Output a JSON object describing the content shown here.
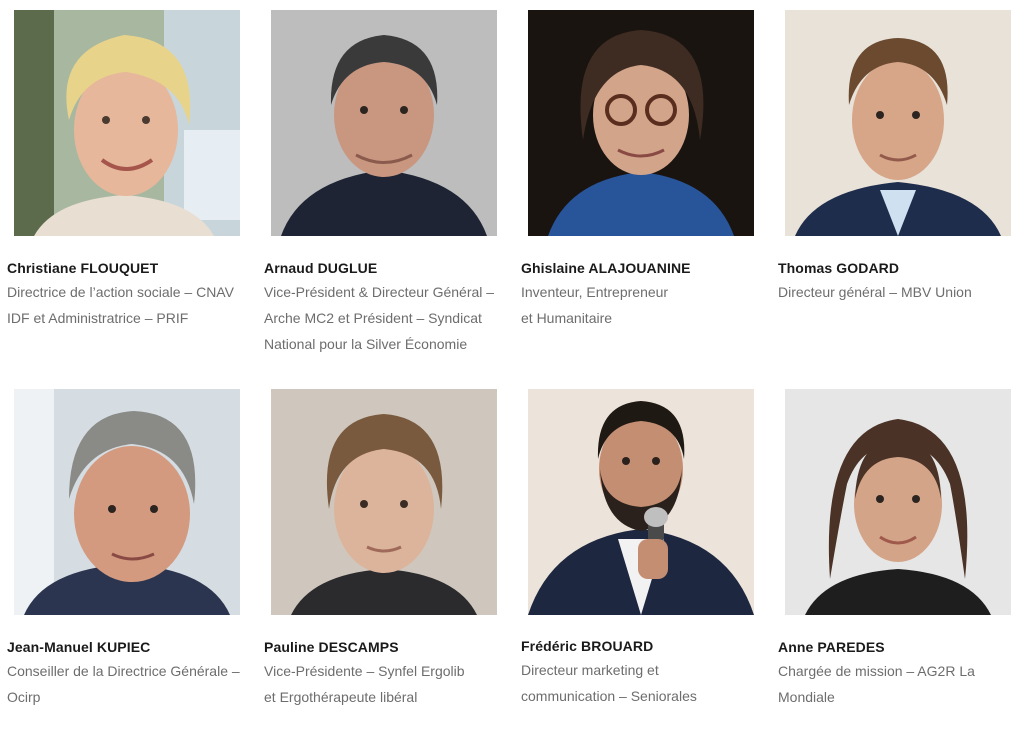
{
  "people": [
    {
      "name": "Christiane FLOUQUET",
      "lines": [
        "Directrice de l’action sociale – CNAV",
        "IDF  et Administratrice – PRIF"
      ]
    },
    {
      "name": "Arnaud DUGLUE",
      "lines": [
        "Vice-Président & Directeur Général –",
        "Arche MC2  et Président – Syndicat",
        "National pour la Silver Économie"
      ]
    },
    {
      "name": "Ghislaine ALAJOUANINE",
      "lines": [
        "Inventeur, Entrepreneur",
        "et Humanitaire"
      ]
    },
    {
      "name": "Thomas GODARD",
      "lines": [
        "Directeur général – MBV Union"
      ]
    },
    {
      "name": "Jean-Manuel KUPIEC",
      "lines": [
        "Conseiller de la Directrice Générale –",
        "Ocirp"
      ]
    },
    {
      "name": "Pauline DESCAMPS",
      "lines": [
        "Vice-Présidente – Synfel Ergolib",
        "et Ergothérapeute libéral"
      ]
    },
    {
      "name": "Frédéric BROUARD",
      "lines": [
        "Directeur marketing et",
        "communication – Seniorales"
      ]
    },
    {
      "name": "Anne PAREDES",
      "lines": [
        "Chargée de mission – AG2R La",
        "Mondiale"
      ]
    }
  ]
}
